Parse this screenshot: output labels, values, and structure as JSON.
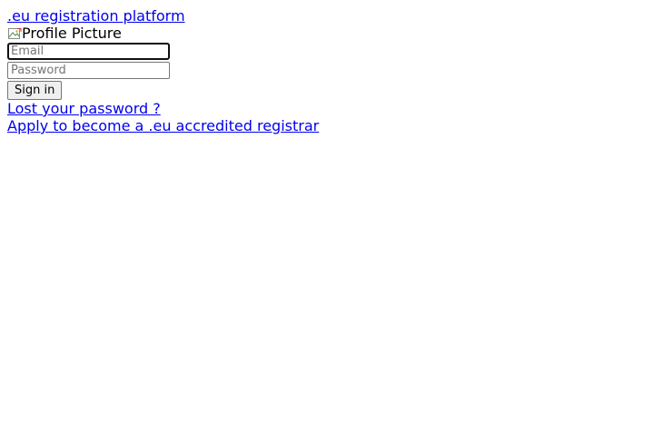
{
  "header": {
    "brand_link": ".eu registration platform"
  },
  "profile": {
    "image_alt": "Profile Picture"
  },
  "login_form": {
    "email_placeholder": "Email",
    "email_value": "",
    "password_placeholder": "Password",
    "password_value": "",
    "signin_label": "Sign in"
  },
  "links": {
    "lost_password": "Lost your password ?",
    "apply_registrar": "Apply to become a .eu accredited registrar"
  },
  "colors": {
    "link": "#0000ee",
    "background": "#ffffff"
  }
}
